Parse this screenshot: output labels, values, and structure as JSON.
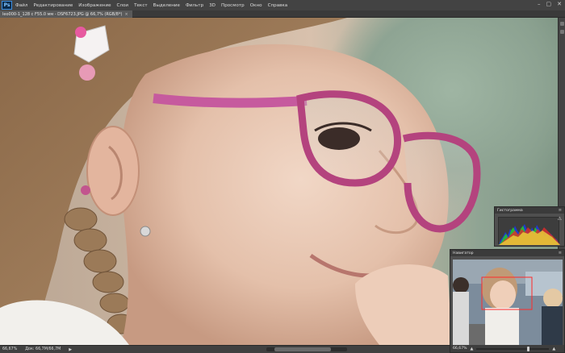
{
  "app": {
    "logo": "Ps"
  },
  "menu": [
    "Файл",
    "Редактирование",
    "Изображение",
    "Слои",
    "Текст",
    "Выделение",
    "Фильтр",
    "3D",
    "Просмотр",
    "Окно",
    "Справка"
  ],
  "window_controls": {
    "minimize": "–",
    "maximize": "▢",
    "close": "✕"
  },
  "document": {
    "tab_title": "leo000-1_128 с F55.0 мм - DSF6723.JPG @ 66,7% (RGB/8*)",
    "close_glyph": "×"
  },
  "histogram": {
    "title": "Гистограмма",
    "menu_glyph": "≡",
    "warning_glyph": "⚠"
  },
  "navigator": {
    "title": "Навигатор",
    "menu_glyph": "≡",
    "zoom_text": "66,67%",
    "zoom_out_glyph": "▲",
    "zoom_in_glyph": "▲",
    "slider_position": 0.72
  },
  "status": {
    "zoom": "66,67%",
    "doc_info": "Док: 66,7M/66,7M",
    "arrow": "▶"
  },
  "colors": {
    "accent": "#3d8ee0",
    "panel_bg": "#4f4f4f",
    "chrome": "#434343"
  }
}
